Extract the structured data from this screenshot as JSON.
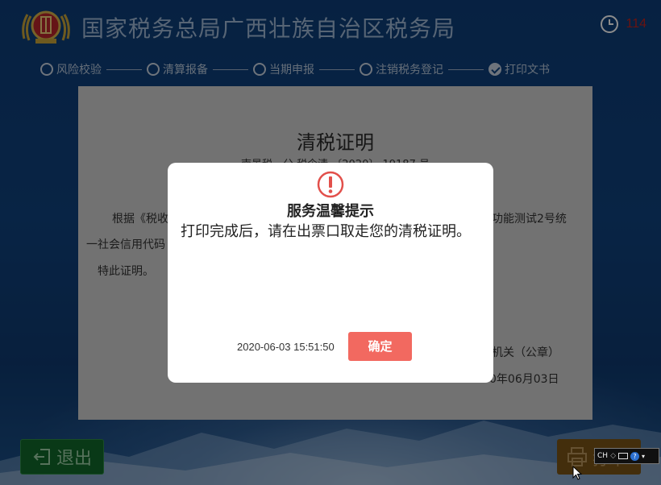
{
  "header": {
    "title": "国家税务总局广西壮族自治区税务局",
    "countdown": "114"
  },
  "steps": [
    {
      "label": "风险校验",
      "done": false
    },
    {
      "label": "清算报备",
      "done": false
    },
    {
      "label": "当期申报",
      "done": false
    },
    {
      "label": "注销税务登记",
      "done": false
    },
    {
      "label": "打印文书",
      "done": true
    }
  ],
  "document": {
    "title": "清税证明",
    "number": "南景税一分 税企清 〔2020〕 19187 号",
    "line1_left": "根据《税收",
    "line1_right": "功能测试2号统",
    "line2_left": "一社会信用代码",
    "line3": "特此证明。",
    "seal_text": "机关（公章）",
    "date_text": "0年06月03日"
  },
  "modal": {
    "title": "服务温馨提示",
    "message": "打印完成后，请在出票口取走您的清税证明。",
    "timestamp": "2020-06-03 15:51:50",
    "ok_label": "确定"
  },
  "footer": {
    "exit_label": "退出",
    "print_label": "打印"
  },
  "tray": {
    "ime": "CH"
  },
  "colors": {
    "background": "#10427e",
    "countdown": "#c0241e",
    "ok_button": "#f26960",
    "exit_button": "#12692a",
    "print_button": "#7a5516",
    "warning_icon": "#e2504b"
  }
}
